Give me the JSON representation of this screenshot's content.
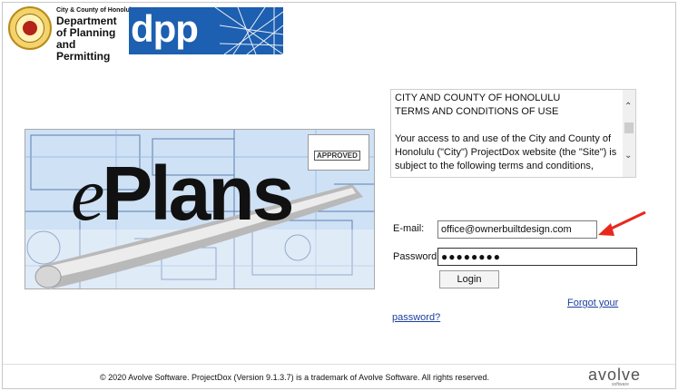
{
  "header": {
    "small_title": "City & County of Honolulu",
    "dept_title": "Department of Planning and Permitting",
    "dpp_logo": "dpp"
  },
  "banner": {
    "approved_stamp": "APPROVED",
    "eplans_e": "e",
    "eplans_rest": "Plans"
  },
  "terms": {
    "heading1": "CITY AND COUNTY OF HONOLULU",
    "heading2": "TERMS AND CONDITIONS OF USE",
    "body": "Your access to and use of the City and County of Honolulu (\"City\") ProjectDox website (the \"Site\") is subject to the following terms and conditions,"
  },
  "login": {
    "email_label": "E-mail:",
    "email_value": "office@ownerbuiltdesign.com",
    "password_label": "Password:",
    "password_value": "●●●●●●●●",
    "login_button": "Login",
    "forgot_link_1": "Forgot your",
    "forgot_link_2": "password?"
  },
  "footer": {
    "copyright": "© 2020 Avolve Software. ProjectDox (Version 9.1.3.7) is a trademark of Avolve Software. All rights reserved.",
    "avolve_logo": "avolve",
    "avolve_sub": "software"
  },
  "colors": {
    "dpp_blue": "#1d5fb0",
    "link_blue": "#1a3fa0",
    "arrow_red": "#e8281c"
  }
}
